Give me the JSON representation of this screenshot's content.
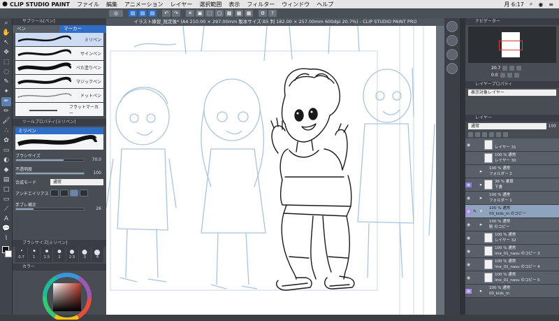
{
  "menubar": {
    "app_name": "CLIP STUDIO PAINT",
    "items": [
      "ファイル",
      "編集",
      "アニメーション",
      "レイヤー",
      "選択範囲",
      "表示",
      "フィルター",
      "ウィンドウ",
      "ヘルプ"
    ],
    "clock": "月 6:17"
  },
  "document_title": "イラスト練習_既定後* (A4 210.00 × 297.00mm 製本サイズ:B5 判 182.00 × 257.00mm 600dpi 20.7%) - CLIP STUDIO PAINT PRO",
  "subtool_panel": {
    "header": "サブツール[ペン]",
    "tabs": [
      "ペン",
      "マーカー"
    ],
    "brushes": [
      "ミリペン",
      "サインペン",
      "べた塗りペン",
      "マジックペン",
      "ドットペン",
      "フラットマーカー"
    ]
  },
  "tool_property": {
    "header": "ツールプロパティ[ミリペン]",
    "title": "ミリペン",
    "brush_size_label": "ブラシサイズ",
    "brush_size_value": "70.0",
    "opacity_label": "不透明度",
    "opacity_value": "100",
    "blend_label": "合成モード",
    "blend_value": "通常",
    "antialias_label": "アンチエイリアス",
    "stabilization_label": "手ブレ補正",
    "stabilization_value": "26"
  },
  "brush_size_panel": {
    "header": "ブラシサイズ[ミリペン]",
    "sizes": [
      "0.7",
      "1",
      "1.5",
      "2",
      "2.5",
      "3",
      "4"
    ]
  },
  "color_panel": {
    "header": "カラー"
  },
  "navigator": {
    "header": "ナビゲーター",
    "zoom": "20.7",
    "rotation": "0.0"
  },
  "layer_property": {
    "header": "レイヤープロパティ",
    "reference_label": "表示対象レイヤー"
  },
  "layer_panel": {
    "header": "レイヤー",
    "blend_mode": "通常",
    "opacity": "100",
    "layers": [
      {
        "line1": "",
        "line2": "レイヤー 31"
      },
      {
        "line1": "100 % 通常",
        "line2": "レイヤー 30"
      },
      {
        "line1": "100 % 通常",
        "line2": "フォルダー 2"
      },
      {
        "line1": "36 % 乗算",
        "line2": "下書"
      },
      {
        "line1": "100 % 通常",
        "line2": "フォルダー 1"
      },
      {
        "line1": "100 % 通常",
        "line2": "00_kids_m のコピー"
      },
      {
        "line1": "100 % 通常",
        "line2": "靴 のコピー"
      },
      {
        "line1": "100 % 通常",
        "line2": "レイヤー 32"
      },
      {
        "line1": "100 % 通常",
        "line2": "line_01_nasu のコピー 3"
      },
      {
        "line1": "100 % 通常",
        "line2": "line_01_nasu のコピー 4"
      },
      {
        "line1": "100 % 通常",
        "line2": "line_01_nasu のコピー 5"
      },
      {
        "line1": "100 % 通常",
        "line2": "00_kids_m"
      }
    ]
  },
  "colors": {
    "accent": "#2f6ec6",
    "sketch_line": "#a9c4df",
    "ink": "#1a1a1a"
  }
}
